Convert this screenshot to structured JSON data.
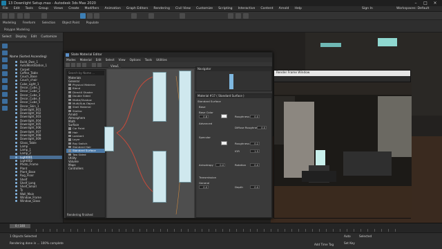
{
  "window": {
    "title": "13 Downlight Setup.max - Autodesk 3ds Max 2020"
  },
  "menu": [
    "File",
    "Edit",
    "Tools",
    "Group",
    "Views",
    "Create",
    "Modifiers",
    "Animation",
    "Graph Editors",
    "Rendering",
    "Civil View",
    "Customize",
    "Scripting",
    "Interactive",
    "Content",
    "Arnold",
    "Help"
  ],
  "signin": {
    "label": "Sign In",
    "workspaces": "Workspaces: Default"
  },
  "ribbon": {
    "tabs": [
      "Modeling",
      "Freeform",
      "Selection",
      "Object Paint",
      "Populate"
    ],
    "group_label": "Polygon Modeling"
  },
  "scene_explorer": {
    "tabs": [
      "Select",
      "Display",
      "Edit",
      "Customize"
    ],
    "column_header": "Name (Sorted Ascending)",
    "items": [
      "Build_Dwn_1",
      "AutoWorkStation_1",
      "Carpet",
      "Coffee_Table",
      "Couch_Base",
      "Couch_chair",
      "Cube_Light_1",
      "Decor_Cube_1",
      "Decor_Cube_2",
      "Decor_Cube_3",
      "Decor_Cube_4",
      "Decor_Cube_5",
      "Decor_Skin_1",
      "Downlight_001",
      "Downlight_002",
      "Downlight_003",
      "Downlight_004",
      "Downlight_005",
      "Downlight_006",
      "Downlight_007",
      "Downlight_008",
      "Downlight_009",
      "Glass_Table",
      "Lamp",
      "Lamp_1",
      "Lamp_2",
      "Light001",
      "Light002",
      "Photo_Frame",
      "Plant",
      "Plant_Base",
      "Rug_Floor",
      "Shelf",
      "Shelf_Long",
      "Shelf_Small",
      "Ty",
      "Wall_Main",
      "Window_Frame",
      "Window_Glass"
    ],
    "selected_index": 26
  },
  "slate": {
    "title": "Slate Material Editor",
    "menu": [
      "Modes",
      "Material",
      "Edit",
      "Select",
      "View",
      "Options",
      "Tools",
      "Utilities"
    ],
    "search_placeholder": "Search by Name ...",
    "view_tab": "View1",
    "browser": [
      {
        "group": "Materials",
        "items": []
      },
      {
        "group": "General",
        "items": [
          "Physical Material",
          "Blend",
          "DirectX Shader",
          "Double Sided",
          "Matte/Shadow",
          "Multi/Sub-Object",
          "Shell Material",
          "Shellac"
        ]
      },
      {
        "group": "Arnold",
        "items": []
      },
      {
        "group": "Atmosphere",
        "items": []
      },
      {
        "group": "Math",
        "items": []
      },
      {
        "group": "Surface",
        "items": [
          "Car Paint",
          "Hair",
          "Lambert",
          "Layer",
          "Ray Switch",
          "Standard Hair",
          "Standard Surface",
          "Two Sided"
        ]
      },
      {
        "group": "Utility",
        "items": []
      },
      {
        "group": "Volume",
        "items": []
      },
      {
        "group": "Maps",
        "items": []
      },
      {
        "group": "Controllers",
        "items": []
      }
    ],
    "selected_item": "Standard Surface",
    "navigator": "Navigator",
    "params_header": "Material #17 ( Standard Surface )",
    "params_sub": "Standard Surface",
    "params": [
      {
        "section": "Base",
        "fields": [
          {
            "label": "Base Color",
            "value": "0.8"
          },
          {
            "label": "Roughness",
            "value": "0.0"
          }
        ]
      },
      {
        "section": "Advanced",
        "fields": [
          {
            "label": "Diffuse Roughness",
            "value": "0.0"
          }
        ]
      },
      {
        "section": "Specular",
        "fields": [
          {
            "label": "Roughness",
            "value": "0.2"
          },
          {
            "label": "IOR",
            "value": "1.5"
          },
          {
            "label": "Anisotropy",
            "value": "0.0"
          },
          {
            "label": "Rotation",
            "value": "0.0"
          }
        ]
      },
      {
        "section": "Transmission",
        "fields": [
          {
            "label": "General",
            "value": "0.0"
          },
          {
            "label": "Depth",
            "value": "0.0"
          }
        ]
      }
    ],
    "status": "Rendering finished"
  },
  "render_window": {
    "title": "Render Frame Window"
  },
  "timeline": {
    "frame": "0 / 100"
  },
  "statusbar": {
    "objects": "1 Objects Selected",
    "prompt": "Rendering done in ... 100% complete",
    "add_time_tag": "Add Time Tag",
    "auto": "Auto",
    "set_key": "Set Key",
    "selected": "Selected"
  }
}
